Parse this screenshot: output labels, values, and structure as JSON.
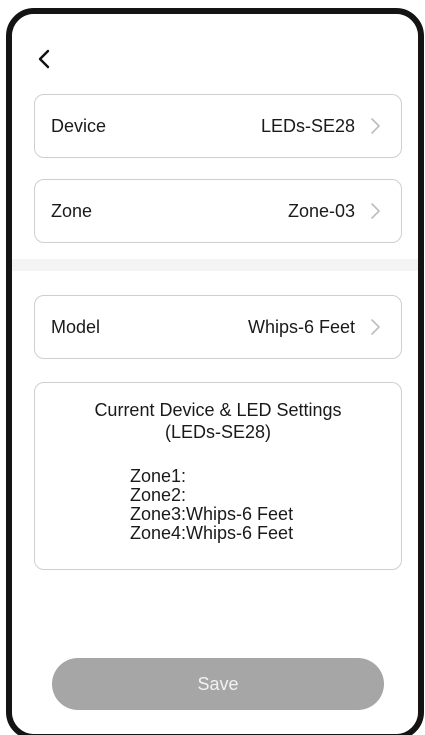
{
  "nav": {
    "back_icon": "chevron-left-icon"
  },
  "rows": [
    {
      "label": "Device",
      "value": "LEDs-SE28",
      "icon": "chevron-right-icon"
    },
    {
      "label": "Zone",
      "value": "Zone-03",
      "icon": "chevron-right-icon"
    },
    {
      "label": "Model",
      "value": "Whips-6 Feet",
      "icon": "chevron-right-icon"
    }
  ],
  "settings": {
    "title_line1": "Current Device & LED Settings",
    "title_line2": "(LEDs-SE28)",
    "zones": [
      "Zone1:",
      "Zone2:",
      "Zone3:Whips-6 Feet",
      "Zone4:Whips-6 Feet"
    ]
  },
  "save_label": "Save",
  "colors": {
    "frame": "#141414",
    "card_border": "#cfcfcf",
    "save_button_bg": "#a6a6a6",
    "save_button_text": "#f2f2f2",
    "divider": "#f4f4f4",
    "chevron": "#bdbdbd"
  }
}
